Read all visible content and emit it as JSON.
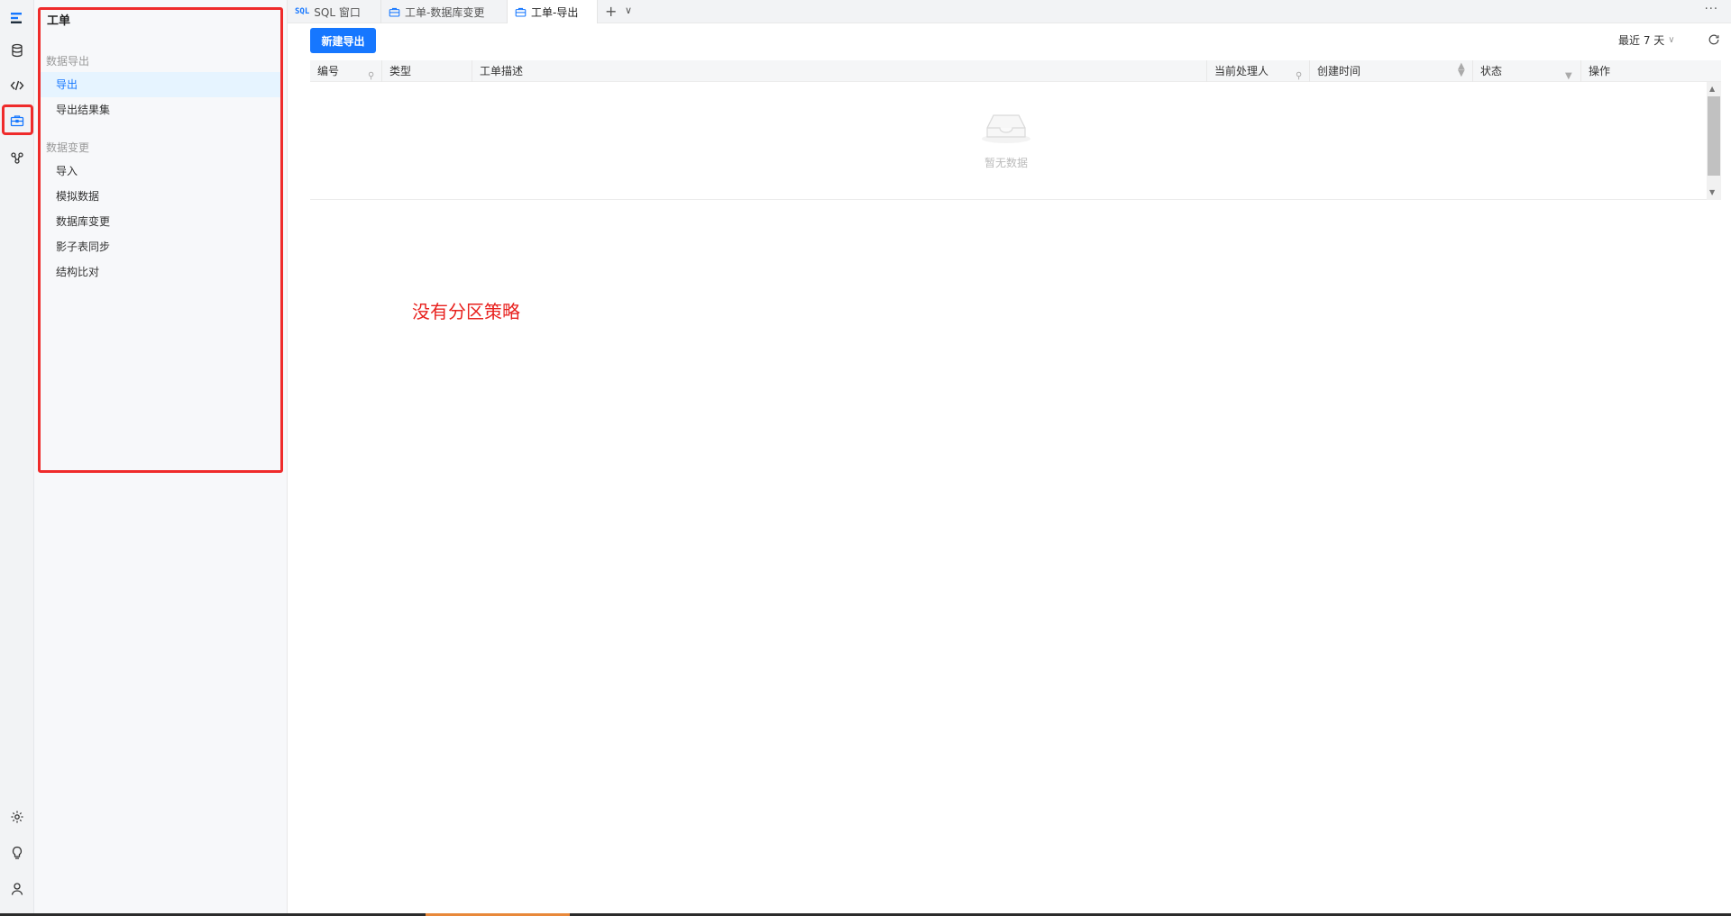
{
  "rail": {
    "icons": [
      "logo-icon",
      "database-icon",
      "code-icon",
      "briefcase-icon",
      "integration-icon",
      "settings-icon",
      "lightbulb-icon",
      "user-icon"
    ]
  },
  "sidebar": {
    "title": "工单",
    "groups": [
      {
        "title": "数据导出",
        "items": [
          "导出",
          "导出结果集"
        ]
      },
      {
        "title": "数据变更",
        "items": [
          "导入",
          "模拟数据",
          "数据库变更",
          "影子表同步",
          "结构比对"
        ]
      }
    ],
    "active_item": "导出"
  },
  "tabs": [
    {
      "label": "SQL 窗口",
      "badge": "SQL",
      "active": false
    },
    {
      "label": "工单-数据库变更",
      "active": false
    },
    {
      "label": "工单-导出",
      "active": true
    }
  ],
  "toolbar": {
    "new_button": "新建导出",
    "time_range": "最近 7 天"
  },
  "table": {
    "columns": [
      "编号",
      "类型",
      "工单描述",
      "当前处理人",
      "创建时间",
      "状态",
      "操作"
    ],
    "rows": [],
    "empty_text": "暂无数据"
  },
  "annotation": "没有分区策略",
  "colors": {
    "primary": "#1677ff",
    "highlight": "#ef2b2b"
  }
}
